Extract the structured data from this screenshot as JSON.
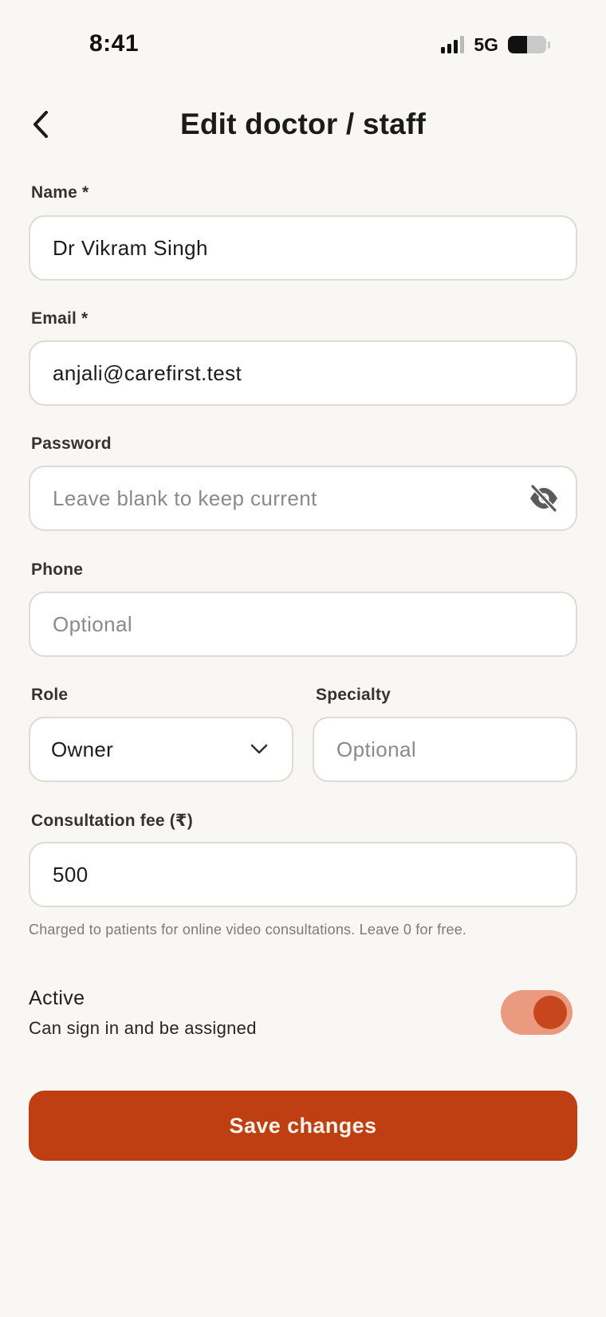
{
  "status_bar": {
    "time": "8:41",
    "network": "5G",
    "battery_level": 0.5,
    "signal_icon": "cellular-signal-icon",
    "battery_icon": "battery-icon"
  },
  "header": {
    "title": "Edit doctor / staff",
    "back_icon": "chevron-left-icon"
  },
  "form": {
    "name": {
      "label": "Name *",
      "value": "Dr Vikram Singh",
      "placeholder": ""
    },
    "email": {
      "label": "Email *",
      "value": "anjali@carefirst.test",
      "placeholder": ""
    },
    "password": {
      "label": "Password",
      "value": "",
      "placeholder": "Leave blank to keep current",
      "visibility_icon": "eye-off-icon"
    },
    "phone": {
      "label": "Phone",
      "value": "",
      "placeholder": "Optional"
    },
    "role": {
      "label": "Role",
      "selected": "Owner",
      "dropdown_icon": "chevron-down-icon"
    },
    "specialty": {
      "label": "Specialty",
      "value": "",
      "placeholder": "Optional"
    },
    "consultation_fee": {
      "label": "Consultation fee (₹)",
      "value": "500",
      "placeholder": "",
      "helper": "Charged to patients for online video consultations. Leave 0 for free."
    },
    "active": {
      "title": "Active",
      "subtitle": "Can sign in and be assigned",
      "enabled": true
    }
  },
  "actions": {
    "save_label": "Save changes"
  },
  "colors": {
    "background": "#f8f7f3",
    "accent": "#c03f12",
    "toggle_track": "#e99a7f",
    "toggle_knob": "#c8461b",
    "input_border": "#dddbd5"
  }
}
